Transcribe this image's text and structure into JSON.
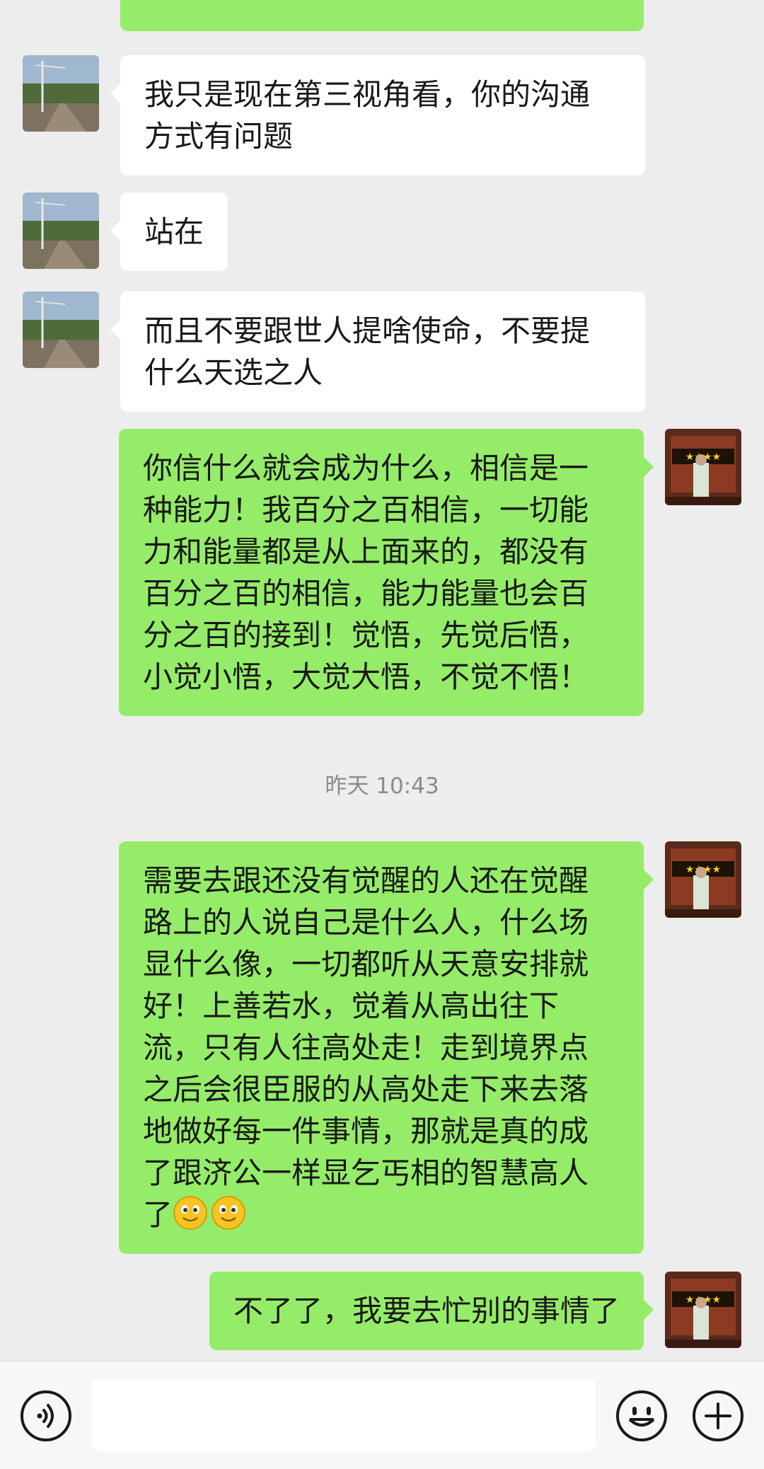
{
  "messages": [
    {
      "side": "in",
      "lines": [
        "我只是现在第三视角看，你的沟通",
        "方式有问题"
      ]
    },
    {
      "side": "in",
      "lines": [
        "站在"
      ]
    },
    {
      "side": "in",
      "lines": [
        "而且不要跟世人提啥使命，不要提",
        "什么天选之人"
      ]
    },
    {
      "side": "out",
      "lines": [
        "你信什么就会成为什么，相信是一",
        "种能力！我百分之百相信，一切能",
        "力和能量都是从上面来的，都没有",
        "百分之百的相信，能力能量也会百",
        "分之百的接到！觉悟，先觉后悟，",
        "小觉小悟，大觉大悟，不觉不悟！"
      ]
    },
    {
      "side": "out",
      "lines": [
        "需要去跟还没有觉醒的人还在觉醒",
        "路上的人说自己是什么人，什么场",
        "显什么像，一切都听从天意安排就",
        "好！上善若水，觉着从高出往下",
        "流，只有人往高处走！走到境界点",
        "之后会很臣服的从高处走下来去落",
        "地做好每一件事情，那就是真的成",
        "了跟济公一样显乞丐相的智慧高人",
        "了"
      ],
      "trailing_emoji": [
        "smile-emoji",
        "smile-emoji"
      ]
    },
    {
      "side": "out",
      "lines": [
        "不了了，我要去忙别的事情了"
      ]
    }
  ],
  "timestamp": "昨天 10:43",
  "icons": {
    "voice": "voice-icon",
    "emoji": "emoji-icon",
    "plus": "plus-icon"
  },
  "colors": {
    "background": "#ededed",
    "outgoing_bubble": "#95ec69",
    "incoming_bubble": "#ffffff"
  }
}
